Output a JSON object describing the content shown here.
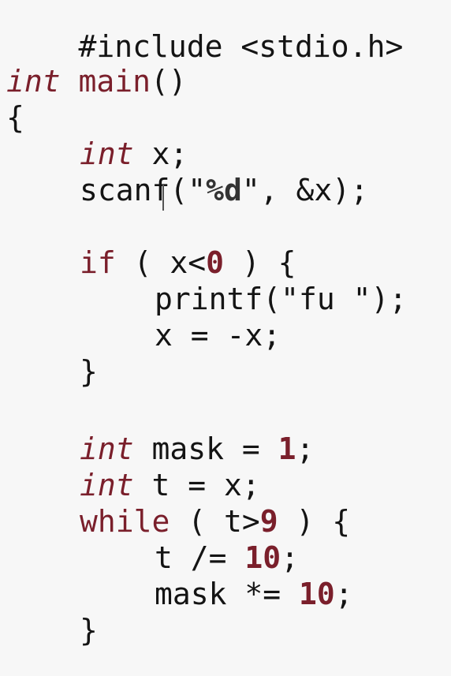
{
  "code": {
    "include": "#include <stdio.h>",
    "int_kw": "int",
    "main_name": "main",
    "main_parens": "()",
    "open_brace": "{",
    "x_decl": " x;",
    "scanf_name": "scanf",
    "scanf_open": "(\"",
    "scanf_fmt": "%d",
    "scanf_rest": "\", &x);",
    "if_kw": "if",
    "if_cond_a": " ( x<",
    "if_zero": "0",
    "if_cond_b": " ) {",
    "printf_line": "printf(\"fu \");",
    "neg_line": "x = -x;",
    "close_brace": "}",
    "mask_decl": " mask = ",
    "one": "1",
    "semicolon": ";",
    "t_decl": " t = x;",
    "while_kw": "while",
    "while_cond_a": " ( t>",
    "nine": "9",
    "while_cond_b": " ) {",
    "t_div": "t /= ",
    "ten": "10",
    "mask_mul": "mask *= "
  },
  "colors": {
    "keyword": "#7a1f2b",
    "text": "#141414",
    "background": "#f7f7f7"
  }
}
